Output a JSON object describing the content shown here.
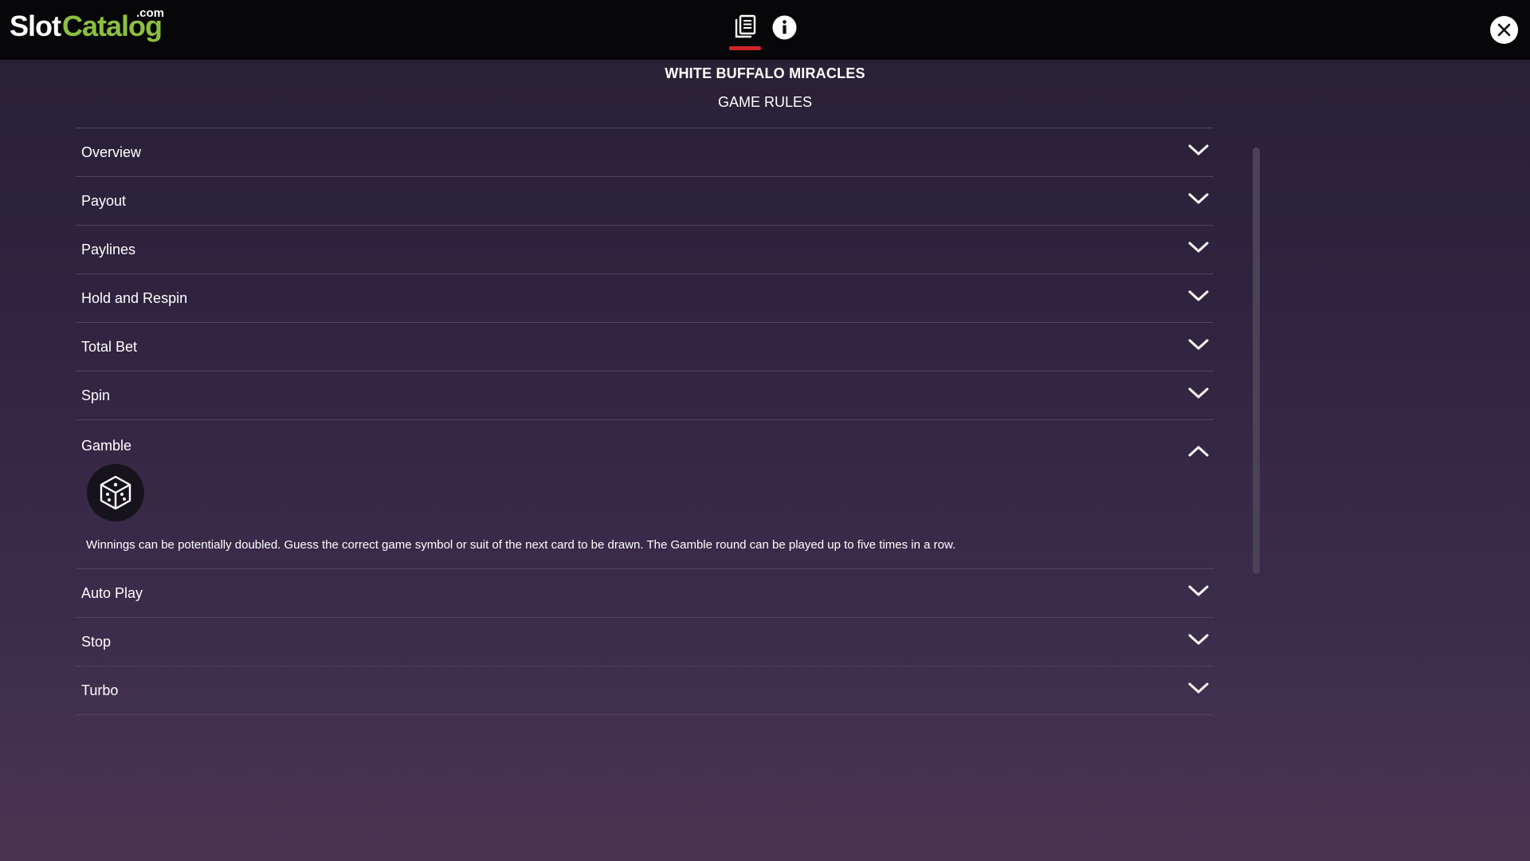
{
  "app": {
    "logo_main": "Slot",
    "logo_accent": "Catalog",
    "logo_suffix": ".com",
    "accent_color": "#8cbf3f",
    "active_tab_color": "#d2232a"
  },
  "header": {
    "tabs": [
      {
        "name": "rules",
        "icon": "rules-book-icon",
        "active": true
      },
      {
        "name": "info",
        "icon": "info-icon",
        "active": false
      }
    ],
    "close_icon": "close-icon"
  },
  "page": {
    "title": "WHITE BUFFALO MIRACLES",
    "subtitle": "GAME RULES"
  },
  "sections": [
    {
      "label": "Overview",
      "expanded": false
    },
    {
      "label": "Payout",
      "expanded": false
    },
    {
      "label": "Paylines",
      "expanded": false
    },
    {
      "label": "Hold and Respin",
      "expanded": false
    },
    {
      "label": "Total Bet",
      "expanded": false
    },
    {
      "label": "Spin",
      "expanded": false
    },
    {
      "label": "Gamble",
      "expanded": true,
      "icon": "dice-icon",
      "text": "Winnings can be potentially doubled. Guess the correct game symbol or suit of the next card to be drawn. The Gamble round can be played up to five times in a row."
    },
    {
      "label": "Auto Play",
      "expanded": false
    },
    {
      "label": "Stop",
      "expanded": false
    },
    {
      "label": "Turbo",
      "expanded": false
    }
  ]
}
